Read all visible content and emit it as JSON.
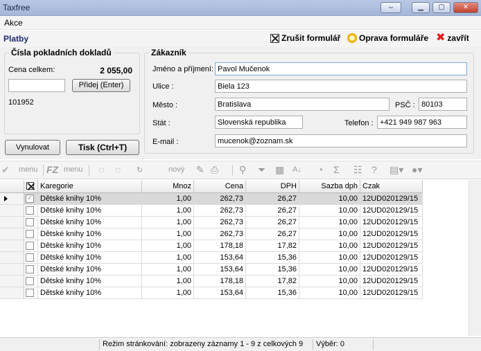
{
  "window": {
    "title": "Taxfree"
  },
  "menu": {
    "items": [
      "Akce"
    ]
  },
  "header": {
    "section_title": "Platby",
    "cancel_form": "Zrušit formulář",
    "fix_form": "Oprava formuláře",
    "close": "zavřít"
  },
  "docs_panel": {
    "title": "Čísla pokladních dokladů",
    "total_label": "Cena celkem:",
    "total_value": "2 055,00",
    "doc_input_value": "",
    "add_button": "Přidej (Enter)",
    "doc_number": "101952",
    "cancel_button": "Vynulovat",
    "print_button": "Tisk (Ctrl+T)"
  },
  "customer": {
    "title": "Zákazník",
    "name_label": "Jméno a příjmení:",
    "name_value": "Pavol Mučenok",
    "street_label": "Ulice :",
    "street_value": "Biela 123",
    "city_label": "Město :",
    "city_value": "Bratislava",
    "zip_label": "PSČ :",
    "zip_value": "80103",
    "state_label": "Stát :",
    "state_value": "Slovenská republika",
    "phone_label": "Telefon :",
    "phone_value": "+421 949 987 963",
    "email_label": "E-mail :",
    "email_value": "mucenok@zoznam.sk"
  },
  "toolbar": {
    "menu1": "menu",
    "fz": "FZ",
    "menu2": "menu",
    "new": "nový"
  },
  "grid": {
    "columns": [
      "Karegorie",
      "Mnoz",
      "Cena",
      "DPH",
      "Sazba dph",
      "Czak"
    ],
    "rows": [
      [
        "Dětské knihy 10%",
        "1,00",
        "262,73",
        "26,27",
        "10,00",
        "12UD020129/15"
      ],
      [
        "Dětské knihy 10%",
        "1,00",
        "262,73",
        "26,27",
        "10,00",
        "12UD020129/15"
      ],
      [
        "Dětské knihy 10%",
        "1,00",
        "262,73",
        "26,27",
        "10,00",
        "12UD020129/15"
      ],
      [
        "Dětské knihy 10%",
        "1,00",
        "262,73",
        "26,27",
        "10,00",
        "12UD020129/15"
      ],
      [
        "Dětské knihy 10%",
        "1,00",
        "178,18",
        "17,82",
        "10,00",
        "12UD020129/15"
      ],
      [
        "Dětské knihy 10%",
        "1,00",
        "153,64",
        "15,36",
        "10,00",
        "12UD020129/15"
      ],
      [
        "Dětské knihy 10%",
        "1,00",
        "153,64",
        "15,36",
        "10,00",
        "12UD020129/15"
      ],
      [
        "Dětské knihy 10%",
        "1,00",
        "178,18",
        "17,82",
        "10,00",
        "12UD020129/15"
      ],
      [
        "Dětské knihy 10%",
        "1,00",
        "153,64",
        "15,36",
        "10,00",
        "12UD020129/15"
      ]
    ]
  },
  "status": {
    "paging": "Režim stránkování: zobrazeny záznamy 1 - 9 z celkových 9",
    "selection": "Výběr: 0"
  }
}
